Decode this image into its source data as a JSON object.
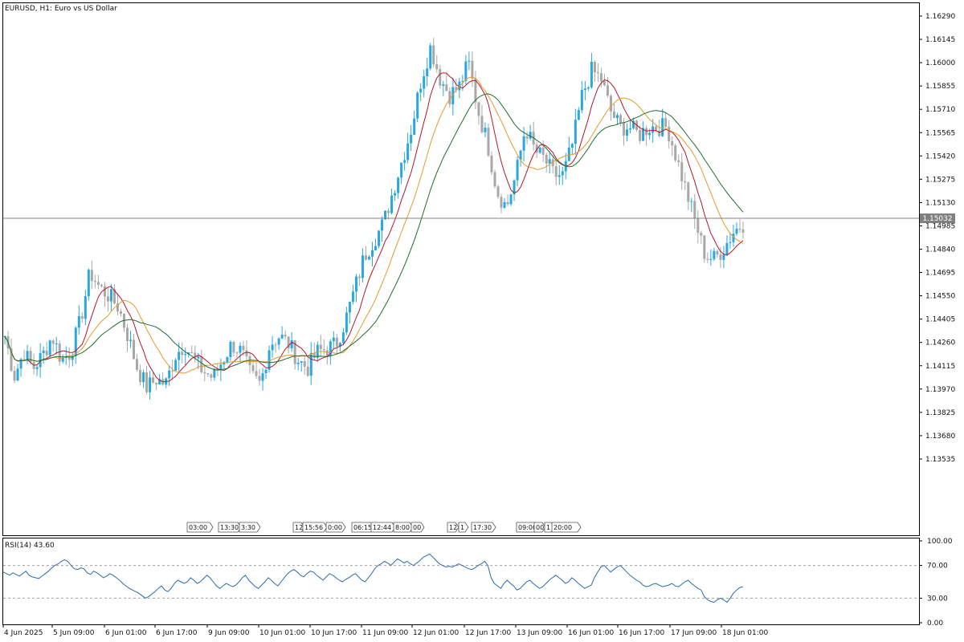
{
  "chart_data": {
    "type": "candlestick",
    "symbol": "EURUSD",
    "title": "EURUSD, H1:  Euro vs US Dollar",
    "timeframe": "H1",
    "current_price": "1.15032",
    "current_price_value": 1.15032,
    "y_range": [
      1.1342,
      1.1641
    ],
    "price_ticks": [
      "1.16290",
      "1.16145",
      "1.16000",
      "1.15855",
      "1.15710",
      "1.15565",
      "1.15420",
      "1.15275",
      "1.15130",
      "1.14985",
      "1.14840",
      "1.14695",
      "1.14550",
      "1.14405",
      "1.14260",
      "1.14115",
      "1.13970",
      "1.13825",
      "1.13680",
      "1.13535"
    ],
    "x_tick_labels": [
      "4 Jun 2025",
      "5 Jun 09:00",
      "6 Jun 01:00",
      "6 Jun 17:00",
      "9 Jun 09:00",
      "10 Jun 01:00",
      "10 Jun 17:00",
      "11 Jun 09:00",
      "12 Jun 01:00",
      "12 Jun 17:00",
      "13 Jun 09:00",
      "16 Jun 01:00",
      "16 Jun 17:00",
      "17 Jun 09:00",
      "18 Jun 01:00"
    ],
    "event_labels": [
      "03:00",
      "13:30",
      "3:30",
      "12",
      "15:56",
      "0:00",
      "06:15",
      "12:44",
      "8:00",
      "00",
      "12",
      "1",
      "17:30",
      "09:00",
      "00",
      "1",
      "20:00"
    ],
    "price_anchor_series": [
      1.143,
      1.1405,
      1.142,
      1.141,
      1.1418,
      1.143,
      1.1415,
      1.142,
      1.144,
      1.147,
      1.146,
      1.1455,
      1.1448,
      1.143,
      1.141,
      1.1398,
      1.1403,
      1.14,
      1.1418,
      1.1425,
      1.1415,
      1.1408,
      1.1404,
      1.1415,
      1.1425,
      1.142,
      1.1405,
      1.14,
      1.1425,
      1.143,
      1.1425,
      1.1415,
      1.141,
      1.142,
      1.1422,
      1.1425,
      1.144,
      1.146,
      1.148,
      1.149,
      1.15,
      1.152,
      1.154,
      1.156,
      1.159,
      1.161,
      1.159,
      1.158,
      1.1585,
      1.16,
      1.157,
      1.155,
      1.152,
      1.151,
      1.153,
      1.156,
      1.1545,
      1.154,
      1.153,
      1.153,
      1.155,
      1.158,
      1.1595,
      1.159,
      1.157,
      1.156,
      1.156,
      1.1555,
      1.156,
      1.156,
      1.156,
      1.154,
      1.152,
      1.15,
      1.148,
      1.1478,
      1.1485,
      1.1495,
      1.15
    ],
    "candle_colors": {
      "up": "#2aa7de",
      "down": "#a8a8a8"
    },
    "ma_series": [
      {
        "period": "fast",
        "color": "#b5162b"
      },
      {
        "period": "medium",
        "color": "#e59a2a"
      },
      {
        "period": "slow",
        "color": "#1f6e2a"
      }
    ],
    "rsi": {
      "label": "RSI(14) 43.60",
      "levels": [
        "100.00",
        "70.00",
        "30.00",
        "0.00"
      ],
      "level_values": [
        100,
        70,
        30,
        0
      ],
      "line_color": "#2b6cb0",
      "reference_levels": [
        70,
        30
      ],
      "values": [
        62,
        60,
        58,
        61,
        59,
        57,
        60,
        63,
        58,
        56,
        55,
        54,
        57,
        60,
        63,
        67,
        70,
        72,
        75,
        77,
        75,
        70,
        66,
        65,
        67,
        66,
        61,
        59,
        63,
        61,
        58,
        55,
        57,
        60,
        58,
        55,
        52,
        48,
        45,
        42,
        40,
        38,
        36,
        33,
        30,
        32,
        35,
        38,
        42,
        45,
        40,
        38,
        42,
        48,
        52,
        50,
        48,
        50,
        55,
        52,
        48,
        50,
        54,
        58,
        55,
        50,
        45,
        42,
        45,
        48,
        46,
        44,
        46,
        50,
        55,
        58,
        52,
        48,
        44,
        42,
        46,
        50,
        55,
        52,
        48,
        45,
        50,
        55,
        60,
        63,
        65,
        62,
        58,
        56,
        60,
        63,
        62,
        58,
        55,
        52,
        56,
        60,
        58,
        55,
        52,
        50,
        53,
        55,
        58,
        60,
        56,
        52,
        50,
        55,
        60,
        66,
        70,
        72,
        75,
        73,
        70,
        74,
        78,
        76,
        73,
        75,
        72,
        70,
        73,
        76,
        80,
        82,
        84,
        80,
        76,
        72,
        70,
        68,
        69,
        68,
        70,
        72,
        70,
        68,
        66,
        65,
        67,
        70,
        72,
        75,
        70,
        55,
        48,
        45,
        42,
        48,
        52,
        48,
        45,
        40,
        42,
        46,
        50,
        52,
        48,
        45,
        42,
        44,
        48,
        52,
        55,
        58,
        55,
        52,
        48,
        50,
        55,
        52,
        48,
        45,
        42,
        44,
        46,
        55,
        62,
        68,
        70,
        66,
        62,
        65,
        68,
        70,
        66,
        62,
        58,
        55,
        52,
        50,
        46,
        44,
        45,
        47,
        48,
        46,
        44,
        45,
        46,
        48,
        45,
        44,
        47,
        50,
        52,
        48,
        45,
        42,
        40,
        32,
        28,
        26,
        25,
        28,
        30,
        28,
        25,
        30,
        36,
        40,
        43,
        44
      ]
    }
  }
}
